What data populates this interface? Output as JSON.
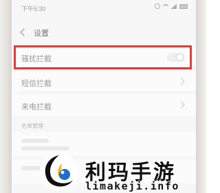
{
  "status_bar": {
    "time": "下午5:30",
    "icons": [
      "alarm-icon",
      "wifi-icon",
      "signal-icon",
      "battery-icon"
    ]
  },
  "header": {
    "back_icon": "chevron-left-icon",
    "title": "设置"
  },
  "settings": {
    "items": [
      {
        "label": "骚扰拦截",
        "control": "toggle",
        "toggle_on": false,
        "highlighted": true
      },
      {
        "label": "短信拦截",
        "control": "chevron"
      },
      {
        "label": "来电拦截",
        "control": "chevron"
      }
    ],
    "section_header": "名单管理"
  },
  "watermark": {
    "brand": "利玛手游",
    "domain": "limakeji.info"
  },
  "colors": {
    "highlight": "#e23a3a",
    "background": "#f7f7f7",
    "logo_blue": "#1a6fd1"
  }
}
